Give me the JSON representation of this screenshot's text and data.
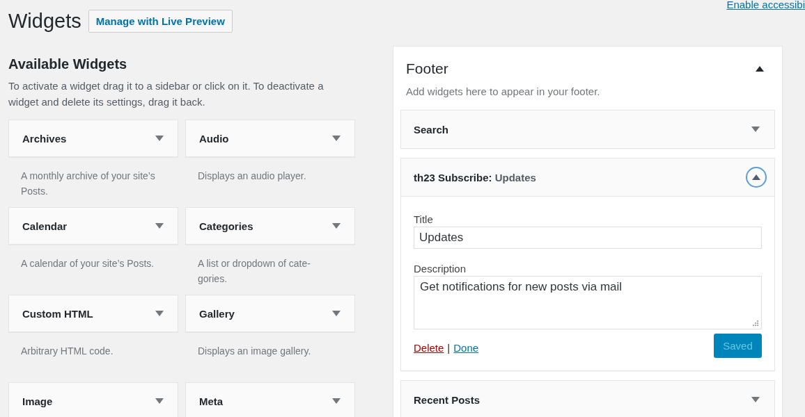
{
  "page": {
    "title": "Widgets",
    "live_preview_button": "Manage with Live Preview",
    "accessibility_link": "Enable accessibi"
  },
  "available": {
    "heading": "Available Widgets",
    "description": "To activate a widget drag it to a sidebar or click on it. To deactivate a widget and delete its settings, drag it back.",
    "widgets": [
      {
        "name": "Archives",
        "description": "A monthly archive of your site’s Posts."
      },
      {
        "name": "Audio",
        "description": "Displays an audio player."
      },
      {
        "name": "Calendar",
        "description": "A calendar of your site’s Posts."
      },
      {
        "name": "Categories",
        "description": "A list or dropdown of cate-gories."
      },
      {
        "name": "Custom HTML",
        "description": "Arbitrary HTML code."
      },
      {
        "name": "Gallery",
        "description": "Displays an image gallery."
      },
      {
        "name": "Image"
      },
      {
        "name": "Meta"
      }
    ]
  },
  "sidebar": {
    "title": "Footer",
    "expanded": true,
    "description": "Add widgets here to appear in your footer.",
    "widgets": [
      {
        "name": "Search",
        "expanded": false
      },
      {
        "name": "th23 Subscribe:",
        "instance_title": "Updates",
        "expanded": true,
        "fields": [
          {
            "kind": "text",
            "label": "Title",
            "value": "Updates"
          },
          {
            "kind": "textarea",
            "label": "Description",
            "value": "Get notifications for new posts via mail"
          }
        ],
        "delete_link": "Delete",
        "separator": "|",
        "done_link": "Done",
        "save_button": "Saved",
        "save_disabled": true
      },
      {
        "name": "Recent Posts",
        "expanded": false
      }
    ]
  }
}
